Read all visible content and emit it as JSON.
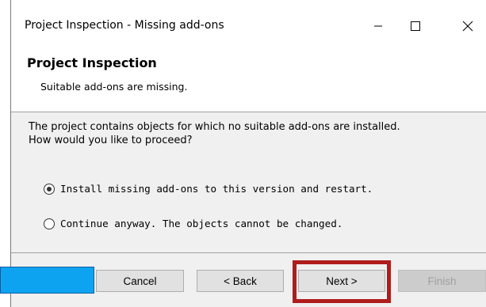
{
  "window": {
    "title": "Project Inspection - Missing add-ons",
    "controls": {
      "minimize_icon": "minimize-icon",
      "maximize_icon": "maximize-icon",
      "close_icon": "close-icon"
    }
  },
  "header": {
    "title": "Project Inspection",
    "subtitle": "Suitable add-ons are missing."
  },
  "body": {
    "description_line1": "The project contains objects for which no suitable add-ons are installed.",
    "description_line2": "How would you like to proceed?",
    "options": [
      {
        "label": "Install missing add-ons to this version and restart.",
        "selected": true
      },
      {
        "label": "Continue anyway. The objects cannot be changed.",
        "selected": false
      }
    ]
  },
  "footer": {
    "cancel_label": "Cancel",
    "back_label": "< Back",
    "next_label": "Next >",
    "finish_label": "Finish",
    "finish_enabled": false
  },
  "colors": {
    "highlight": "#b01c1c",
    "overlay_blue": "#0ea3f0",
    "dialog_background": "#f0f0f0"
  }
}
